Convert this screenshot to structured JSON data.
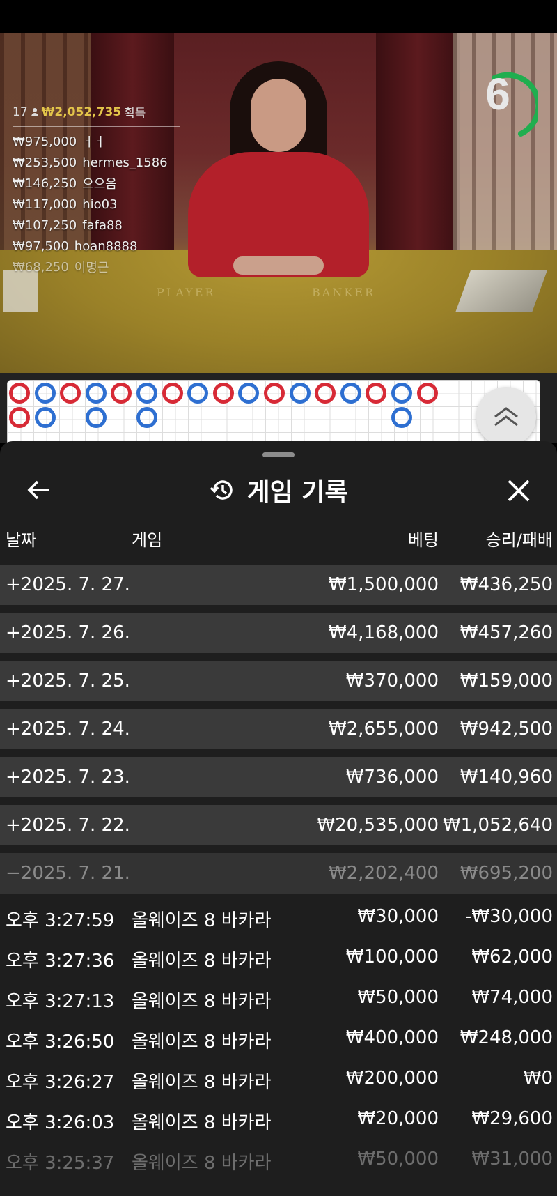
{
  "video": {
    "felt_player": "PLAYER",
    "felt_banker": "BANKER",
    "timer_value": "6",
    "bettors_count": "17",
    "bettors_total": "₩2,052,735",
    "bettors_total_suffix": "획득",
    "bettors": [
      {
        "amount": "₩975,000",
        "name": "ㅓㅓ"
      },
      {
        "amount": "₩253,500",
        "name": "hermes_1586"
      },
      {
        "amount": "₩146,250",
        "name": "으으음"
      },
      {
        "amount": "₩117,000",
        "name": "hio03"
      },
      {
        "amount": "₩107,250",
        "name": "fafa88"
      },
      {
        "amount": "₩97,500",
        "name": "hoan8888"
      },
      {
        "amount": "₩68,250",
        "name": "이명근"
      }
    ]
  },
  "road": {
    "top_row": [
      "red",
      "blue",
      "red",
      "blue",
      "red",
      "blue",
      "red",
      "blue",
      "red",
      "blue",
      "red",
      "blue",
      "red",
      "blue",
      "red",
      "blue",
      "red"
    ],
    "second_row": [
      {
        "col": 0,
        "color": "red"
      },
      {
        "col": 1,
        "color": "blue"
      },
      {
        "col": 3,
        "color": "blue"
      },
      {
        "col": 5,
        "color": "blue"
      },
      {
        "col": 15,
        "color": "blue"
      }
    ]
  },
  "sheet": {
    "title": "게임 기록",
    "columns": {
      "date": "날짜",
      "game": "게임",
      "bet": "베팅",
      "result": "승리/패배"
    },
    "days": [
      {
        "date": "+2025. 7. 27.",
        "bet": "₩1,500,000",
        "result": "₩436,250"
      },
      {
        "date": "+2025. 7. 26.",
        "bet": "₩4,168,000",
        "result": "₩457,260"
      },
      {
        "date": "+2025. 7. 25.",
        "bet": "₩370,000",
        "result": "₩159,000"
      },
      {
        "date": "+2025. 7. 24.",
        "bet": "₩2,655,000",
        "result": "₩942,500"
      },
      {
        "date": "+2025. 7. 23.",
        "bet": "₩736,000",
        "result": "₩140,960"
      },
      {
        "date": "+2025. 7. 22.",
        "bet": "₩20,535,000",
        "result": "₩1,052,640"
      },
      {
        "date": "−2025. 7. 21.",
        "bet": "₩2,202,400",
        "result": "₩695,200"
      }
    ],
    "transactions": [
      {
        "time": "오후 3:27:59",
        "game": "올웨이즈 8 바카라",
        "bet": "₩30,000",
        "result": "-₩30,000"
      },
      {
        "time": "오후 3:27:36",
        "game": "올웨이즈 8 바카라",
        "bet": "₩100,000",
        "result": "₩62,000"
      },
      {
        "time": "오후 3:27:13",
        "game": "올웨이즈 8 바카라",
        "bet": "₩50,000",
        "result": "₩74,000"
      },
      {
        "time": "오후 3:26:50",
        "game": "올웨이즈 8 바카라",
        "bet": "₩400,000",
        "result": "₩248,000"
      },
      {
        "time": "오후 3:26:27",
        "game": "올웨이즈 8 바카라",
        "bet": "₩200,000",
        "result": "₩0"
      },
      {
        "time": "오후 3:26:03",
        "game": "올웨이즈 8 바카라",
        "bet": "₩20,000",
        "result": "₩29,600"
      },
      {
        "time": "오후 3:25:37",
        "game": "올웨이즈 8 바카라",
        "bet": "₩50,000",
        "result": "₩31,000"
      }
    ]
  },
  "colors": {
    "road_red": "#d72a36",
    "road_blue": "#2e6fd1",
    "timer_green": "#1fae4f",
    "total_gold": "#e3c54a"
  }
}
